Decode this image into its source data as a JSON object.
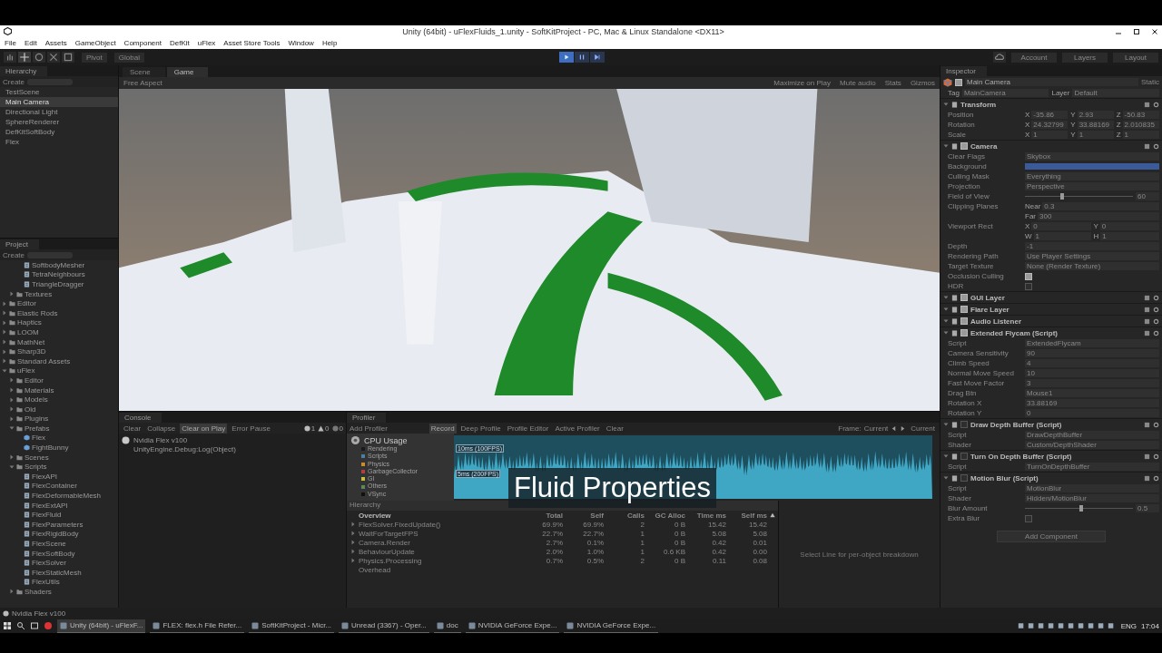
{
  "window": {
    "title": "Unity (64bit) - uFlexFluids_1.unity - SoftKitProject - PC, Mac & Linux Standalone <DX11>"
  },
  "menu": [
    "File",
    "Edit",
    "Assets",
    "GameObject",
    "Component",
    "DefKit",
    "uFlex",
    "Asset Store Tools",
    "Window",
    "Help"
  ],
  "toolbar": {
    "pivot": "Pivot",
    "space": "Global",
    "play_buttons": [
      {
        "kind": "play",
        "selected": true
      },
      {
        "kind": "pause",
        "selected": false
      },
      {
        "kind": "step",
        "selected": false
      }
    ],
    "account": "Account",
    "layers": "Layers",
    "layout": "Layout"
  },
  "hierarchy": {
    "tab": "Hierarchy",
    "create": "Create",
    "items": [
      {
        "name": "TestScene",
        "selected": false
      },
      {
        "name": "Main Camera",
        "selected": true
      },
      {
        "name": "Directional Light",
        "selected": false
      },
      {
        "name": "SphereRenderer",
        "selected": false
      },
      {
        "name": "DefKitSoftBody",
        "selected": false
      },
      {
        "name": "Flex",
        "selected": false
      }
    ]
  },
  "project": {
    "tab": "Project",
    "create": "Create",
    "tree": [
      {
        "children": [
          {
            "children": [
              {
                "name": "SoftbodyMesher",
                "kind": "script"
              },
              {
                "name": "TetraNeighbours",
                "kind": "script"
              },
              {
                "name": "TriangleDragger",
                "kind": "script"
              }
            ]
          },
          {
            "name": "Textures",
            "kind": "folder",
            "expanded": false
          }
        ]
      },
      {
        "name": "Editor",
        "kind": "folder",
        "expanded": false
      },
      {
        "name": "Elastic Rods",
        "kind": "folder",
        "expanded": false
      },
      {
        "name": "Haptics",
        "kind": "folder",
        "expanded": false
      },
      {
        "name": "LOOM",
        "kind": "folder",
        "expanded": false
      },
      {
        "name": "MathNet",
        "kind": "folder",
        "expanded": false
      },
      {
        "name": "Sharp3D",
        "kind": "folder",
        "expanded": false
      },
      {
        "name": "Standard Assets",
        "kind": "folder",
        "expanded": false
      },
      {
        "name": "uFlex",
        "kind": "folder",
        "expanded": true,
        "children": [
          {
            "name": "Editor",
            "kind": "folder",
            "expanded": false
          },
          {
            "name": "Materials",
            "kind": "folder",
            "expanded": false
          },
          {
            "name": "Models",
            "kind": "folder",
            "expanded": false
          },
          {
            "name": "Old",
            "kind": "folder",
            "expanded": false
          },
          {
            "name": "Plugins",
            "kind": "folder",
            "expanded": false
          },
          {
            "name": "Prefabs",
            "kind": "folder",
            "expanded": true,
            "children": [
              {
                "name": "Flex",
                "kind": "prefab"
              },
              {
                "name": "FightBunny",
                "kind": "prefab"
              }
            ]
          },
          {
            "name": "Scenes",
            "kind": "folder",
            "expanded": false
          },
          {
            "name": "Scripts",
            "kind": "folder",
            "expanded": true,
            "children": [
              {
                "name": "FlexAPI",
                "kind": "script"
              },
              {
                "name": "FlexContainer",
                "kind": "script"
              },
              {
                "name": "FlexDeformableMesh",
                "kind": "script"
              },
              {
                "name": "FlexExtAPI",
                "kind": "script"
              },
              {
                "name": "FlexFluid",
                "kind": "script"
              },
              {
                "name": "FlexParameters",
                "kind": "script"
              },
              {
                "name": "FlexRigidBody",
                "kind": "script"
              },
              {
                "name": "FlexScene",
                "kind": "script"
              },
              {
                "name": "FlexSoftBody",
                "kind": "script"
              },
              {
                "name": "FlexSolver",
                "kind": "script"
              },
              {
                "name": "FlexStaticMesh",
                "kind": "script"
              },
              {
                "name": "FlexUtils",
                "kind": "script"
              }
            ]
          },
          {
            "name": "Shaders",
            "kind": "folder",
            "expanded": false
          }
        ]
      }
    ]
  },
  "view": {
    "tabs": [
      {
        "label": "Scene",
        "selected": false
      },
      {
        "label": "Game",
        "selected": true
      }
    ],
    "aspect": "Free Aspect",
    "options": [
      "Maximize on Play",
      "Mute audio",
      "Stats",
      "Gizmos"
    ]
  },
  "console": {
    "tab": "Console",
    "buttons": [
      {
        "label": "Clear",
        "selected": false
      },
      {
        "label": "Collapse",
        "selected": false
      },
      {
        "label": "Clear on Play",
        "selected": true
      },
      {
        "label": "Error Pause",
        "selected": false
      }
    ],
    "counts": [
      "1",
      "0",
      "0"
    ],
    "messages": [
      {
        "text": "Nvidia Flex v100",
        "detail": "UnityEngine.Debug:Log(Object)"
      }
    ]
  },
  "profiler": {
    "tab": "Profiler",
    "add": "Add Profiler",
    "buttons": [
      {
        "label": "Record",
        "selected": true
      },
      {
        "label": "Deep Profile",
        "selected": false
      },
      {
        "label": "Profile Editor",
        "selected": false
      },
      {
        "label": "Active Profiler",
        "selected": false
      },
      {
        "label": "Clear",
        "selected": false
      }
    ],
    "frame_label": "Frame:",
    "frame_value": "Current",
    "current": "Current",
    "cpu_title": "CPU Usage",
    "legend": [
      {
        "name": "Rendering",
        "color": "#1a1a1a"
      },
      {
        "name": "Scripts",
        "color": "#4a7fa8"
      },
      {
        "name": "Physics",
        "color": "#d08a2c"
      },
      {
        "name": "GarbageCollector",
        "color": "#b04040"
      },
      {
        "name": "GI",
        "color": "#c8c040"
      },
      {
        "name": "Others",
        "color": "#5a8a5a"
      },
      {
        "name": "VSync",
        "color": "#101010"
      }
    ],
    "graph_labels": [
      "10ms (100FPS)",
      "5ms (200FPS)"
    ],
    "view_mode": "Hierarchy",
    "columns": [
      "Overview",
      "Total",
      "Self",
      "Calls",
      "GC Alloc",
      "Time ms",
      "Self ms"
    ],
    "rows": [
      {
        "expanded": false,
        "cells": [
          "FlexSolver.FixedUpdate()",
          "69.9%",
          "69.9%",
          "2",
          "0 B",
          "15.42",
          "15.42"
        ]
      },
      {
        "expanded": false,
        "cells": [
          "WaitForTargetFPS",
          "22.7%",
          "22.7%",
          "1",
          "0 B",
          "5.08",
          "5.08"
        ]
      },
      {
        "expanded": false,
        "cells": [
          "Camera.Render",
          "2.7%",
          "0.1%",
          "1",
          "0 B",
          "0.42",
          "0.01"
        ]
      },
      {
        "expanded": false,
        "cells": [
          "BehaviourUpdate",
          "2.0%",
          "1.0%",
          "1",
          "0.6 KB",
          "0.42",
          "0.00"
        ]
      },
      {
        "expanded": false,
        "cells": [
          "Physics.Processing",
          "0.7%",
          "0.5%",
          "2",
          "0 B",
          "0.11",
          "0.08"
        ]
      },
      {
        "cells": [
          "Overhead"
        ]
      }
    ],
    "detail_hint": "Select Line for per-object breakdown"
  },
  "caption": "Fluid Properties",
  "inspector": {
    "tab": "Inspector",
    "object": {
      "name": "Main Camera",
      "active": true,
      "static": "Static",
      "tag_label": "Tag",
      "tag": "MainCamera",
      "layer_label": "Layer",
      "layer": "Default"
    },
    "components": [
      {
        "title": "Transform",
        "fields": [
          {
            "label": "Position",
            "kind": "vector",
            "parts": [
              {
                "axis": "X",
                "value": "-35.86"
              },
              {
                "axis": "Y",
                "value": "2.93"
              },
              {
                "axis": "Z",
                "value": "-50.83"
              }
            ]
          },
          {
            "label": "Rotation",
            "kind": "vector",
            "parts": [
              {
                "axis": "X",
                "value": "24.32799"
              },
              {
                "axis": "Y",
                "value": "33.88169"
              },
              {
                "axis": "Z",
                "value": "2.010835"
              }
            ]
          },
          {
            "label": "Scale",
            "kind": "vector",
            "parts": [
              {
                "axis": "X",
                "value": "1"
              },
              {
                "axis": "Y",
                "value": "1"
              },
              {
                "axis": "Z",
                "value": "1"
              }
            ]
          }
        ]
      },
      {
        "title": "Camera",
        "enabled": true,
        "fields": [
          {
            "label": "Clear Flags",
            "kind": "dropdown",
            "value": "Skybox"
          },
          {
            "label": "Background",
            "kind": "color",
            "color": "#3a5a9a"
          },
          {
            "label": "Culling Mask",
            "kind": "dropdown",
            "value": "Everything"
          },
          {
            "label": "Projection",
            "kind": "dropdown",
            "value": "Perspective"
          },
          {
            "label": "Field of View",
            "kind": "slider",
            "level": 0.33,
            "value": "60"
          },
          {
            "label": "Clipping Planes",
            "kind": "vector",
            "parts": [
              {
                "axis": "Near",
                "value": "0.3"
              }
            ]
          },
          {
            "kind": "vector",
            "parts": [
              {
                "axis": "Far",
                "value": "300"
              }
            ]
          },
          {
            "label": "Viewport Rect",
            "kind": "vector",
            "parts": [
              {
                "axis": "X",
                "value": "0"
              },
              {
                "axis": "Y",
                "value": "0"
              }
            ]
          },
          {
            "kind": "vector",
            "parts": [
              {
                "axis": "W",
                "value": "1"
              },
              {
                "axis": "H",
                "value": "1"
              }
            ]
          },
          {
            "label": "Depth",
            "kind": "text",
            "value": "-1"
          },
          {
            "label": "Rendering Path",
            "kind": "dropdown",
            "value": "Use Player Settings"
          },
          {
            "label": "Target Texture",
            "kind": "object",
            "value": "None (Render Texture)"
          },
          {
            "label": "Occlusion Culling",
            "kind": "toggle",
            "checked": true
          },
          {
            "label": "HDR",
            "kind": "toggle",
            "checked": false
          }
        ]
      },
      {
        "title": "GUI Layer",
        "enabled": true
      },
      {
        "title": "Flare Layer",
        "enabled": true
      },
      {
        "title": "Audio Listener",
        "enabled": true
      },
      {
        "title": "Extended Flycam (Script)",
        "enabled": true,
        "fields": [
          {
            "label": "Script",
            "kind": "object",
            "value": "ExtendedFlycam"
          },
          {
            "label": "Camera Sensitivity",
            "kind": "text",
            "value": "90"
          },
          {
            "label": "Climb Speed",
            "kind": "text",
            "value": "4"
          },
          {
            "label": "Normal Move Speed",
            "kind": "text",
            "value": "10"
          },
          {
            "label": "Fast Move Factor",
            "kind": "text",
            "value": "3"
          },
          {
            "label": "Drag Btn",
            "kind": "dropdown",
            "value": "Mouse1"
          },
          {
            "label": "Rotation X",
            "kind": "text",
            "value": "33.88169"
          },
          {
            "label": "Rotation Y",
            "kind": "text",
            "value": "0"
          }
        ]
      },
      {
        "title": "Draw Depth Buffer (Script)",
        "enabled": false,
        "fields": [
          {
            "label": "Script",
            "kind": "object",
            "value": "DrawDepthBuffer"
          },
          {
            "label": "Shader",
            "kind": "object",
            "value": "Custom/DepthShader"
          }
        ]
      },
      {
        "title": "Turn On Depth Buffer (Script)",
        "enabled": false,
        "fields": [
          {
            "label": "Script",
            "kind": "object",
            "value": "TurnOnDepthBuffer"
          }
        ]
      },
      {
        "title": "Motion Blur (Script)",
        "enabled": false,
        "fields": [
          {
            "label": "Script",
            "kind": "object",
            "value": "MotionBlur"
          },
          {
            "label": "Shader",
            "kind": "object",
            "value": "Hidden/MotionBlur"
          },
          {
            "label": "Blur Amount",
            "kind": "slider",
            "level": 0.5,
            "value": "0.5"
          },
          {
            "label": "Extra Blur",
            "kind": "toggle",
            "checked": false
          }
        ]
      }
    ],
    "add_component": "Add Component"
  },
  "status_bar": "Nvidia Flex v100",
  "taskbar": {
    "apps": [
      {
        "label": "Unity (64bit) - uFlexF...",
        "selected": true
      },
      {
        "label": "FLEX: flex.h File Refer...",
        "selected": false
      },
      {
        "label": "SoftKitProject - Micr...",
        "selected": false
      },
      {
        "label": "Unread (3367) - Oper...",
        "selected": false
      },
      {
        "label": "doc",
        "selected": false
      },
      {
        "label": "NVIDIA GeForce Expe...",
        "selected": false
      },
      {
        "label": "NVIDIA GeForce Expe...",
        "selected": false
      }
    ],
    "language": "ENG",
    "time": "17:04"
  }
}
